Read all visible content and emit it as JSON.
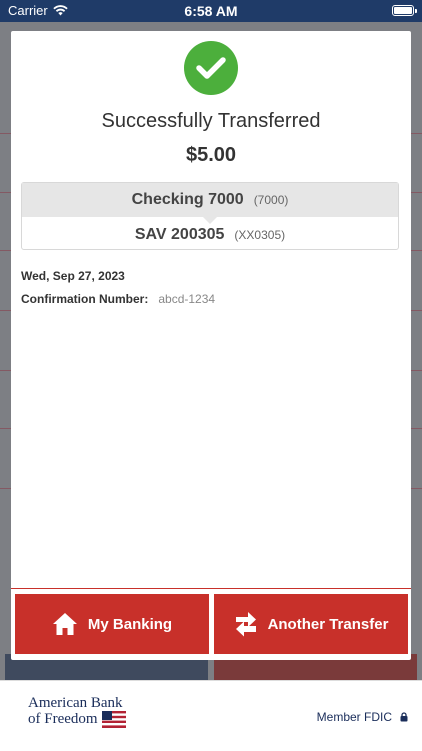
{
  "status_bar": {
    "carrier": "Carrier",
    "time": "6:58 AM"
  },
  "transfer": {
    "success_message": "Successfully Transferred",
    "amount": "$5.00",
    "from_account": {
      "name": "Checking 7000",
      "number": "(7000)"
    },
    "to_account": {
      "name": "SAV 200305",
      "number": "(XX0305)"
    },
    "date": "Wed, Sep 27, 2023",
    "confirmation_label": "Confirmation Number:",
    "confirmation_value": "abcd-1234"
  },
  "actions": {
    "my_banking_label": "My Banking",
    "another_transfer_label": "Another Transfer"
  },
  "footer": {
    "bank_name_line1": "American Bank",
    "bank_name_line2": "of Freedom",
    "fdic_label": "Member FDIC"
  },
  "colors": {
    "accent_red": "#c8302a",
    "success_green": "#4caf3c",
    "navy": "#1f3b68"
  }
}
